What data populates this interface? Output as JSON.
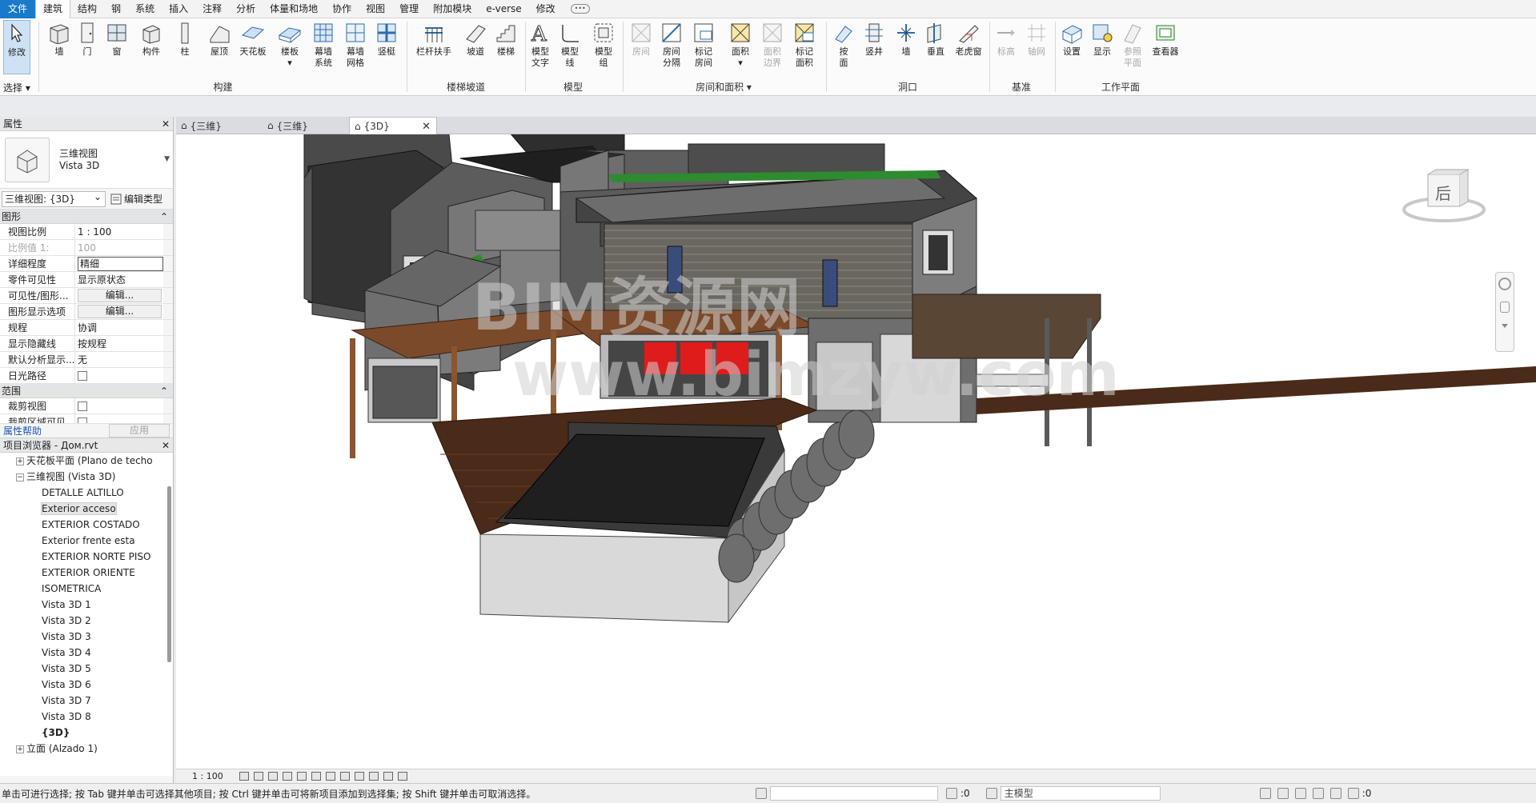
{
  "menu": {
    "file": "文件",
    "tabs": [
      "建筑",
      "结构",
      "钢",
      "系统",
      "插入",
      "注释",
      "分析",
      "体量和场地",
      "协作",
      "视图",
      "管理",
      "附加模块",
      "e-verse",
      "修改"
    ],
    "active_tab": "建筑"
  },
  "ribbon": {
    "select_label": "选择",
    "tools": {
      "modify": "修改",
      "wall": "墙",
      "door": "门",
      "window": "窗",
      "component": "构件",
      "column": "柱",
      "roof": "屋顶",
      "ceiling": "天花板",
      "floor": "楼板",
      "curtain_system": "幕墙\n系统",
      "curtain_grid": "幕墙\n网格",
      "mullion": "竖梃",
      "railing": "栏杆扶手",
      "ramp": "坡道",
      "stair": "楼梯",
      "model_text": "模型\n文字",
      "model_line": "模型\n线",
      "model_group": "模型\n组",
      "room": "房间",
      "room_separator": "房间\n分隔",
      "tag_room": "标记\n房间",
      "area": "面积",
      "area_boundary": "面积\n边界",
      "tag_area": "标记\n面积",
      "by_face": "按\n面",
      "shaft": "竖井",
      "opening_wall": "墙",
      "vertical": "垂直",
      "dormer": "老虎窗",
      "level": "标高",
      "grid": "轴网",
      "set": "设置",
      "show": "显示",
      "ref_plane": "参照\n平面",
      "viewer": "查看器"
    },
    "groups": {
      "build": "构建",
      "circulation": "楼梯坡道",
      "model": "模型",
      "room_area": "房间和面积",
      "opening": "洞口",
      "datum": "基准",
      "work_plane": "工作平面"
    }
  },
  "properties": {
    "title": "属性",
    "type_name_line1": "三维视图",
    "type_name_line2": "Vista 3D",
    "view_selector": "三维视图: {3D}",
    "edit_type": "编辑类型",
    "section_graphics": "图形",
    "rows": [
      {
        "name": "视图比例",
        "value": "1 : 100"
      },
      {
        "name": "比例值 1:",
        "value": "100"
      },
      {
        "name": "详细程度",
        "value": "精细"
      },
      {
        "name": "零件可见性",
        "value": "显示原状态"
      },
      {
        "name": "可见性/图形...",
        "value": "编辑..."
      },
      {
        "name": "图形显示选项",
        "value": "编辑..."
      },
      {
        "name": "规程",
        "value": "协调"
      },
      {
        "name": "显示隐藏线",
        "value": "按规程"
      },
      {
        "name": "默认分析显示...",
        "value": "无"
      },
      {
        "name": "日光路径",
        "value": ""
      }
    ],
    "section_extents": "范围",
    "extents_rows": [
      {
        "name": "裁剪视图",
        "value": ""
      },
      {
        "name": "裁剪区域可见",
        "value": ""
      }
    ],
    "help": "属性帮助",
    "apply": "应用"
  },
  "browser": {
    "title": "项目浏览器 - Дом.rvt",
    "items": [
      {
        "label": "天花板平面 (Plano de techo",
        "level": 1,
        "expander": "+"
      },
      {
        "label": "三维视图 (Vista 3D)",
        "level": 1,
        "expander": "−"
      },
      {
        "label": "DETALLE ALTILLO",
        "level": 2
      },
      {
        "label": "Exterior acceso",
        "level": 2,
        "selected": true
      },
      {
        "label": "EXTERIOR COSTADO",
        "level": 2
      },
      {
        "label": "Exterior frente esta",
        "level": 2
      },
      {
        "label": "EXTERIOR NORTE PISO",
        "level": 2
      },
      {
        "label": "EXTERIOR ORIENTE",
        "level": 2
      },
      {
        "label": "ISOMETRICA",
        "level": 2
      },
      {
        "label": "Vista 3D 1",
        "level": 2
      },
      {
        "label": "Vista 3D 2",
        "level": 2
      },
      {
        "label": "Vista 3D 3",
        "level": 2
      },
      {
        "label": "Vista 3D 4",
        "level": 2
      },
      {
        "label": "Vista 3D 5",
        "level": 2
      },
      {
        "label": "Vista 3D 6",
        "level": 2
      },
      {
        "label": "Vista 3D 7",
        "level": 2
      },
      {
        "label": "Vista 3D 8",
        "level": 2
      },
      {
        "label": "{3D}",
        "level": 2,
        "bold": true
      },
      {
        "label": "立面 (Alzado 1)",
        "level": 1,
        "expander": "+"
      }
    ]
  },
  "view_tabs": [
    {
      "label": "{三维}",
      "active": false
    },
    {
      "label": "{三维}",
      "active": false
    },
    {
      "label": "{3D}",
      "active": true
    }
  ],
  "viewcube_face": "后",
  "watermark": {
    "line1": "BIM资源网",
    "line2": "www.bimzyw.com"
  },
  "view_scale": "1 : 100",
  "status": {
    "hint": "单击可进行选择; 按 Tab 键并单击可选择其他项目; 按 Ctrl 键并单击可将新项目添加到选择集; 按 Shift 键并单击可取消选择。",
    "zero_a": ":0",
    "model": "主模型",
    "filter_count": ":0"
  },
  "colors": {
    "accent": "#1979ca",
    "wall_dark": "#5a5a5a",
    "wood": "#7a4a2a",
    "red": "#e01b1b",
    "green": "#2e8b2e"
  }
}
